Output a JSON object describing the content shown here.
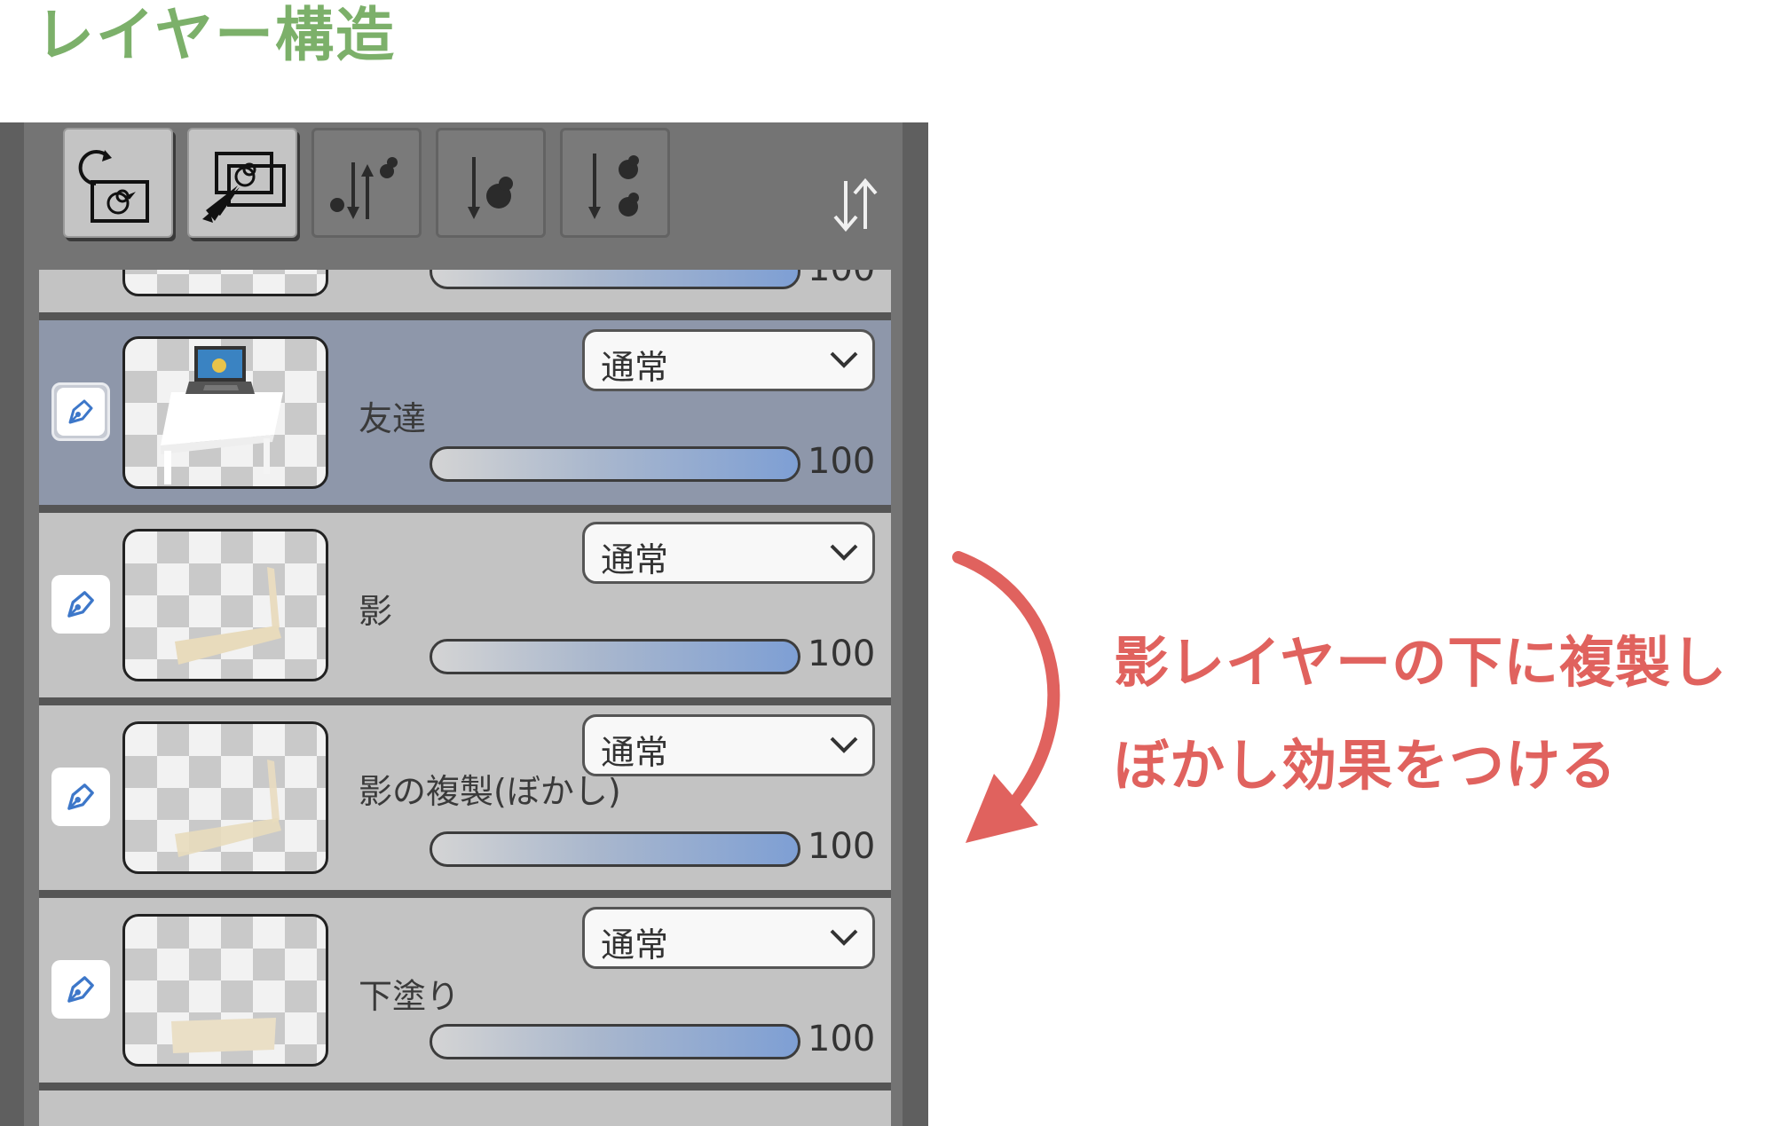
{
  "heading": "レイヤー構造",
  "colors": {
    "heading": "#7cb06a",
    "annotation": "#e0625e",
    "selected_row": "#8e97aa",
    "row": "#c3c3c3"
  },
  "toolbar": {
    "buttons": [
      {
        "icon": "clear-layer-icon",
        "state": "active"
      },
      {
        "icon": "select-layer-icon",
        "state": "active"
      },
      {
        "icon": "swap-layer-icon",
        "state": "disabled"
      },
      {
        "icon": "move-down-icon",
        "state": "disabled"
      },
      {
        "icon": "merge-down-icon",
        "state": "disabled"
      }
    ],
    "sort_icon": "sort-arrows-icon"
  },
  "layers": [
    {
      "name": "",
      "blend": "",
      "opacity": "100",
      "partial": true
    },
    {
      "name": "友達",
      "blend": "通常",
      "opacity": "100",
      "selected": true
    },
    {
      "name": "影",
      "blend": "通常",
      "opacity": "100"
    },
    {
      "name": "影の複製(ぼかし)",
      "blend": "通常",
      "opacity": "100"
    },
    {
      "name": "下塗り",
      "blend": "通常",
      "opacity": "100"
    }
  ],
  "annotation": {
    "line1": "影レイヤーの下に複製し",
    "line2": "ぼかし効果をつける"
  }
}
